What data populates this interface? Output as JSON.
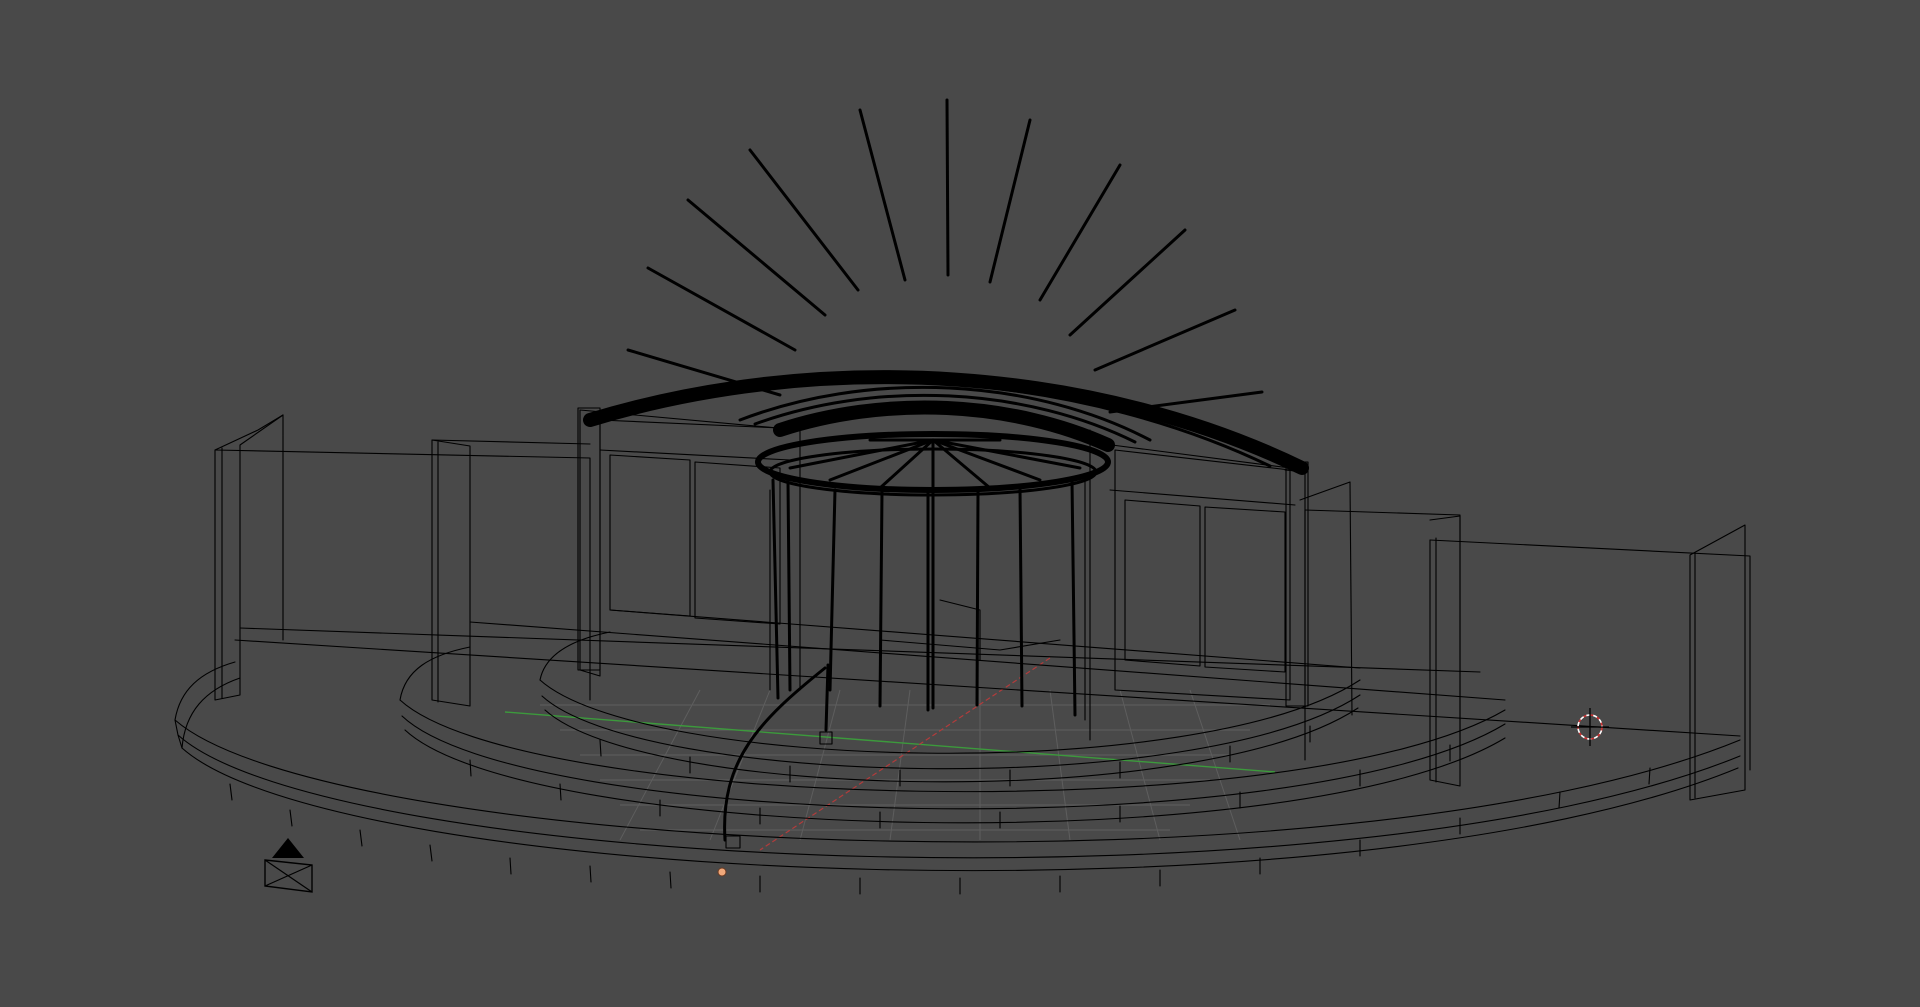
{
  "viewport": {
    "shading": "wireframe",
    "background_color": "#494949",
    "wire_color": "#000000",
    "grid_color": "#5e5e5e",
    "x_axis_color": "#b23c3c",
    "y_axis_color": "#3c9a3c",
    "cursor_color": "#d23232",
    "origin_color": "#f0a87a"
  },
  "objects": [
    {
      "name": "arch",
      "icon": "arch-mesh"
    },
    {
      "name": "dome",
      "icon": "dome-mesh"
    },
    {
      "name": "columns",
      "icon": "column-mesh"
    },
    {
      "name": "steps",
      "icon": "stair-mesh"
    },
    {
      "name": "side-walls",
      "icon": "wall-mesh"
    },
    {
      "name": "stand-cable",
      "icon": "curve"
    },
    {
      "name": "camera",
      "icon": "camera-icon"
    }
  ]
}
